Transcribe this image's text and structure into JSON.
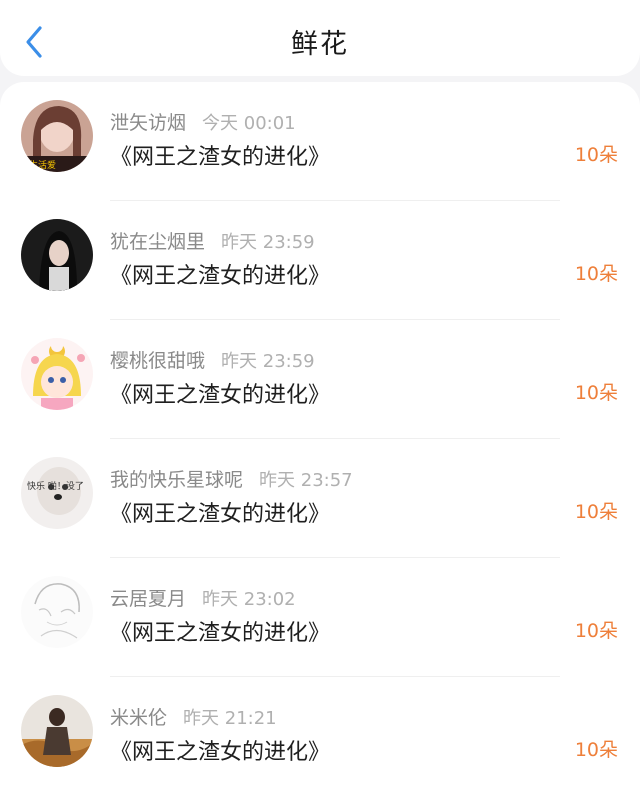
{
  "header": {
    "title": "鲜花",
    "back_icon": "chevron-left-icon",
    "accent_color": "#3b8ee8"
  },
  "count_color": "#ee7f3a",
  "items": [
    {
      "name": "泄矢访烟",
      "time": "今天 00:01",
      "book": "《网王之渣女的进化》",
      "count": "10朵"
    },
    {
      "name": "犹在尘烟里",
      "time": "昨天 23:59",
      "book": "《网王之渣女的进化》",
      "count": "10朵"
    },
    {
      "name": "樱桃很甜哦",
      "time": "昨天 23:59",
      "book": "《网王之渣女的进化》",
      "count": "10朵"
    },
    {
      "name": "我的快乐星球呢",
      "time": "昨天 23:57",
      "book": "《网王之渣女的进化》",
      "count": "10朵"
    },
    {
      "name": "云居夏月",
      "time": "昨天 23:02",
      "book": "《网王之渣女的进化》",
      "count": "10朵"
    },
    {
      "name": "米米伦",
      "time": "昨天 21:21",
      "book": "《网王之渣女的进化》",
      "count": "10朵"
    }
  ],
  "avatar_texts": {
    "item_0": "生活爱",
    "item_3": "快乐 啪！没了"
  }
}
